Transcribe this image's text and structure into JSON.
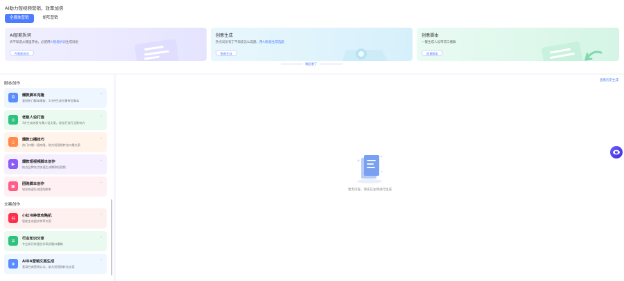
{
  "header": {
    "title": "AI助力短视频营销，效率加倍",
    "tabs": [
      {
        "label": "全媒体营销",
        "active": true
      },
      {
        "label": "矩阵营销",
        "active": false
      }
    ]
  },
  "feature_cards": [
    {
      "title": "AI智能拆词",
      "desc_prefix": "拆不知道从哪里开始，必使用",
      "desc_link": "AI智能拆词",
      "desc_suffix": "生成词组",
      "button": "AI智能拆词"
    },
    {
      "title": "创意生成",
      "desc_prefix": "热点词没有了不知道怎么选题，",
      "desc_link": "用AI智能生成选题",
      "desc_suffix": "",
      "button": "智能生成"
    },
    {
      "title": "创意脚本",
      "desc_prefix": "一键生成人设带货口播稿",
      "desc_link": "",
      "desc_suffix": "",
      "button": "创意脚本"
    }
  ],
  "collapse_label": "收起收了",
  "sidebar": {
    "sections": [
      {
        "label": "脚本创作",
        "items": [
          {
            "title": "爆款脚本克隆",
            "desc": "复制热门脚本模板，1分钟生成专属带货脚本",
            "color": "#5b8cff",
            "bg": "#eef6ff",
            "icon": "⧉"
          },
          {
            "title": "老板人设打造",
            "desc": "3步生成老板专属人设文案，轻松打造行业影响力",
            "color": "#2ec27e",
            "bg": "#eafaf1",
            "icon": "◎"
          },
          {
            "title": "爆款口播技巧",
            "desc": "热门口播一键克隆，助力短视频转化口播文案",
            "color": "#ff8a4c",
            "bg": "#fff3ea",
            "icon": "▯"
          },
          {
            "title": "爆款短视频脚本创作",
            "desc": "结合品牌卖点快速生成爆款短视频",
            "color": "#8b5cf6",
            "bg": "#f5efff",
            "icon": "▶"
          },
          {
            "title": "团购脚本创作",
            "desc": "轻松快速生成团购脚本",
            "color": "#ff5c8a",
            "bg": "#fff0f3",
            "icon": "▣"
          }
        ]
      },
      {
        "label": "文案创作",
        "items": [
          {
            "title": "小红书种草攻略机",
            "desc": "智能生成图文种草文案",
            "color": "#ff2e4d",
            "bg": "#fff0f0",
            "icon": "书"
          },
          {
            "title": "行业知识分享",
            "desc": "专业知识快速创作高质量口播稿",
            "color": "#2ec27e",
            "bg": "#eafaf1",
            "icon": "⊞"
          },
          {
            "title": "AIDA营销文案生成",
            "desc": "套用经典营销公式，助力短视频转化文案",
            "color": "#5b8cff",
            "bg": "#eef6ff",
            "icon": "◈"
          }
        ]
      }
    ]
  },
  "main": {
    "history_link": "查看历史生成",
    "empty_text": "暂无内容，请先在左侧进行生成"
  },
  "colors": {
    "accent": "#4d7cfe"
  },
  "icons": {
    "float_button": "eye-icon",
    "chevron": "chevron-down-icon"
  }
}
